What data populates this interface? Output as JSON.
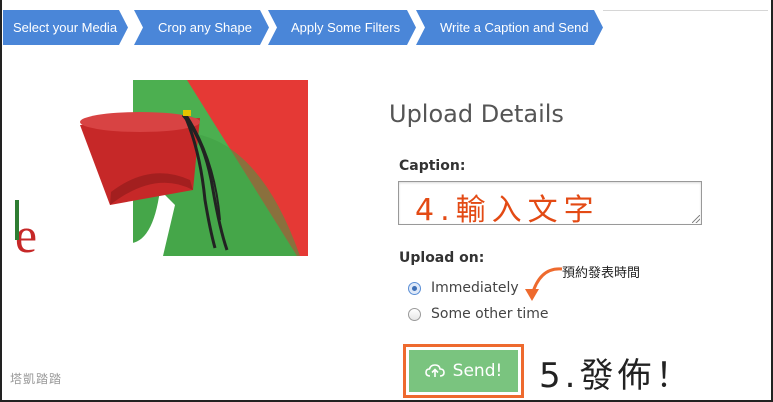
{
  "wizard": {
    "steps": [
      {
        "label": "Select your Media"
      },
      {
        "label": "Crop any Shape"
      },
      {
        "label": "Apply Some Filters"
      },
      {
        "label": "Write a Caption and Send"
      }
    ]
  },
  "media": {
    "preview_text": "le",
    "colors": {
      "red": "#e53935",
      "green": "#43a047",
      "hat": "#c62828"
    }
  },
  "upload": {
    "title": "Upload Details",
    "caption_label": "Caption:",
    "caption_value": "4.輸入文字",
    "upload_on_label": "Upload on:",
    "options": [
      {
        "label": "Immediately",
        "checked": true
      },
      {
        "label": "Some other time",
        "checked": false
      }
    ],
    "schedule_note": "預約發表時間",
    "send_label": "Send!",
    "send_note": "5.發佈！"
  },
  "watermark": "塔凱踏踏",
  "colors": {
    "wizard": "#4a86d8",
    "send": "#7ac47f",
    "highlight": "#ee6a2e",
    "annotation": "#e34a14"
  }
}
